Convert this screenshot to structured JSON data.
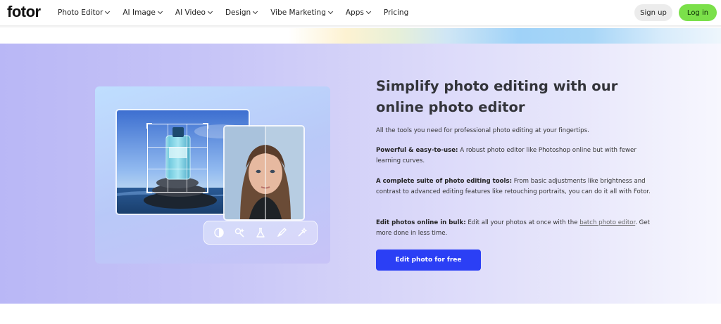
{
  "nav": {
    "logo": "fotor",
    "menu": [
      {
        "label": "Photo Editor",
        "dropdown": true
      },
      {
        "label": "AI Image",
        "dropdown": true
      },
      {
        "label": "AI Video",
        "dropdown": true
      },
      {
        "label": "Design",
        "dropdown": true
      },
      {
        "label": "Vibe Marketing",
        "dropdown": true
      },
      {
        "label": "Apps",
        "dropdown": true
      },
      {
        "label": "Pricing",
        "dropdown": false
      }
    ],
    "signup_label": "Sign up",
    "login_label": "Log in"
  },
  "hero": {
    "headline": "Simplify photo editing with our online photo editor",
    "intro": "All the tools you need for professional photo editing at your fingertips.",
    "feature1_title": "Powerful & easy-to-use:",
    "feature1_text": " A robust photo editor like Photoshop online but with fewer learning curves.",
    "feature2_title": "A complete suite of photo editing tools:",
    "feature2_text": " From basic adjustments like brightness and contrast to advanced editing features like retouching portraits, you can do it all with Fotor.",
    "feature3_title": "Edit photos online in bulk:",
    "feature3_text_before": " Edit all your photos at once with the ",
    "feature3_link": "batch photo editor",
    "feature3_text_after": ". Get more done in less time.",
    "cta_label": "Edit photo for free"
  },
  "toolbar_icons": [
    "adjust-icon",
    "magic-retouch-icon",
    "beauty-icon",
    "brush-icon",
    "magic-wand-icon"
  ],
  "colors": {
    "brand_green": "#7be04a",
    "cta_blue": "#2b3ff5",
    "hero_bg_start": "#b9b7f6"
  }
}
